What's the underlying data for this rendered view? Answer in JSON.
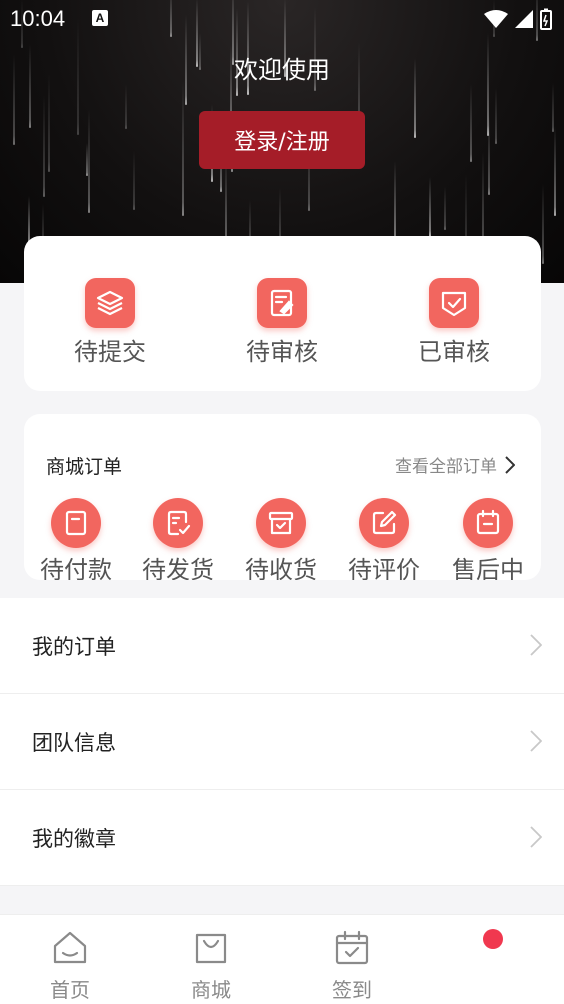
{
  "status_bar": {
    "time": "10:04",
    "notification_letter": "A"
  },
  "header": {
    "welcome": "欢迎使用",
    "login_label": "登录/注册"
  },
  "review": {
    "items": [
      {
        "label": "待提交",
        "icon": "layers-icon"
      },
      {
        "label": "待审核",
        "icon": "document-pen-icon"
      },
      {
        "label": "已审核",
        "icon": "shield-check-icon"
      }
    ]
  },
  "orders": {
    "title": "商城订单",
    "view_all": "查看全部订单",
    "items": [
      {
        "label": "待付款",
        "icon": "wallet-icon"
      },
      {
        "label": "待发货",
        "icon": "receipt-check-icon"
      },
      {
        "label": "待收货",
        "icon": "box-check-icon"
      },
      {
        "label": "待评价",
        "icon": "edit-icon"
      },
      {
        "label": "售后中",
        "icon": "calendar-icon"
      }
    ]
  },
  "menu": [
    {
      "label": "我的订单"
    },
    {
      "label": "团队信息"
    },
    {
      "label": "我的徽章"
    }
  ],
  "tabbar": [
    {
      "label": "首页",
      "icon": "home-icon"
    },
    {
      "label": "商城",
      "icon": "shopping-bag-icon"
    },
    {
      "label": "签到",
      "icon": "calendar-check-icon"
    }
  ],
  "colors": {
    "accent": "#f2665f",
    "login": "#a51d28",
    "badge_dot": "#f0384f"
  }
}
